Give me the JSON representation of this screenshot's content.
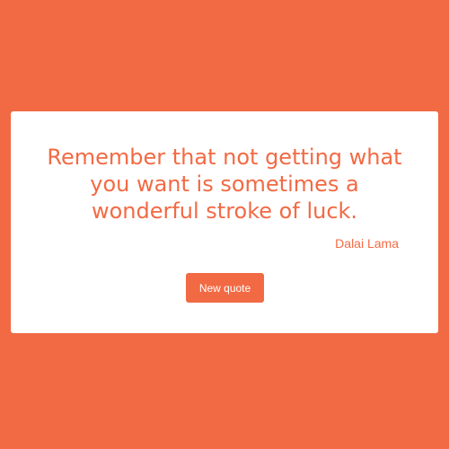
{
  "quote": {
    "text": "Remember that not getting what you want is sometimes a wonderful stroke of luck.",
    "author": "Dalai Lama"
  },
  "actions": {
    "new_quote_label": "New quote"
  },
  "colors": {
    "background": "#f26a44",
    "card": "#ffffff",
    "accent": "#f26a44",
    "button_text": "#ffffff"
  }
}
